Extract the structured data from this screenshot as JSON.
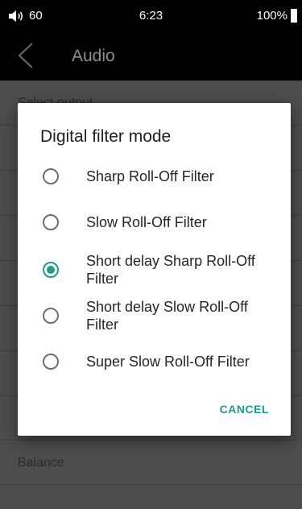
{
  "status_bar": {
    "volume": "60",
    "time": "6:23",
    "battery": "100%"
  },
  "app_bar": {
    "title": "Audio"
  },
  "settings": {
    "rows": [
      "Select output",
      "",
      "",
      "",
      "",
      "",
      "",
      "Balance",
      ""
    ]
  },
  "dialog": {
    "title": "Digital filter mode",
    "options": [
      {
        "label": "Sharp Roll-Off Filter",
        "selected": false
      },
      {
        "label": "Slow Roll-Off Filter",
        "selected": false
      },
      {
        "label": "Short delay Sharp Roll-Off Filter",
        "selected": true
      },
      {
        "label": "Short delay Slow Roll-Off Filter",
        "selected": false
      },
      {
        "label": "Super Slow Roll-Off Filter",
        "selected": false
      }
    ],
    "cancel_label": "CANCEL"
  },
  "colors": {
    "accent": "#1f9a8b",
    "dim_background": "#4d4d4d"
  }
}
